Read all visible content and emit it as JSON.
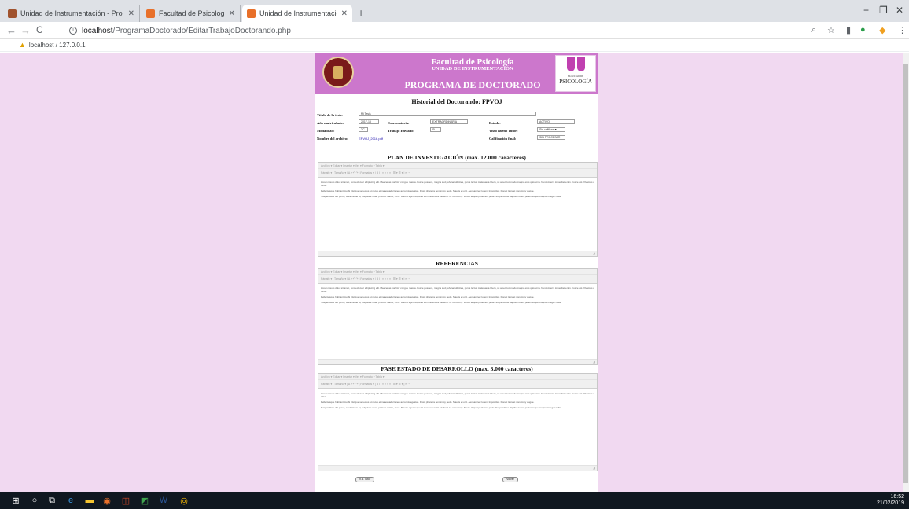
{
  "browser": {
    "tabs": [
      {
        "title": "Unidad de Instrumentación - Pro",
        "fav_color": "#a0522d",
        "active": false
      },
      {
        "title": "Facultad de Psicología. Intranet",
        "fav_color": "#e8702a",
        "active": false
      },
      {
        "title": "Unidad de Instrumentación - Pro",
        "fav_color": "#e8702a",
        "active": true
      }
    ],
    "new_tab": "+",
    "window_controls": {
      "minimize": "−",
      "maximize": "❐",
      "close": "✕"
    },
    "nav": {
      "back": "←",
      "forward": "→",
      "reload": "C"
    },
    "url_host": "localhost",
    "url_path": "/ProgramaDoctorado/EditarTrabajoDoctorando.php",
    "bookmark": "localhost / 127.0.0.1"
  },
  "page": {
    "header": {
      "faculty": "Facultad de Psicología",
      "unit": "UNIDAD DE INSTRUMENTACIÓN",
      "program": "PROGRAMA DE DOCTORADO",
      "logo_small": "FACULTAD DE",
      "logo_big": "PSICOLOGÍA"
    },
    "history_title": "Historial del Doctorando: FPVOJ",
    "fields": {
      "tesis_label": "Título de la tesis:",
      "tesis_value": "Mi Tesis",
      "anio_label": "Año matriculado:",
      "anio_value": "2017-18",
      "conv_label": "Convocatoria:",
      "conv_value": "EXTRAORDINARIA",
      "estado_label": "Estado:",
      "estado_value": "ACTIVO",
      "mod_label": "Modalidad:",
      "mod_value": "TC",
      "trabajo_label": "Trabajo Enviado:",
      "trabajo_value": "Si",
      "visto_label": "Visto Bueno Tutor:",
      "visto_value": "Sin calificar",
      "archivo_label": "Nombre del archivo:",
      "archivo_value": "EPVOJ_2016.pdf",
      "calif_label": "Calificación final:",
      "calif_value": "SIN PROCESAR"
    },
    "editor_menu": "Archivo ▾   Editar ▾   Insertar ▾   Ver ▾   Formato ▾   Tabla ▾",
    "editor_toolbar": "Párrafo ▾  |  Tamaño ▾  |  A ▾  ↶  ↷  |  Formatos ▾  |  B   I  |  ≡  ≡  ≡  ≡  |  ☰ ▾  ☰ ▾  |  ⇤  ⇥",
    "lorem1": "Lorem ipsum dolor sit amet, consectetuer adipiscing elit. Maecenas porttitor congue massa. Fusce posuere, magna sed pulvinar ultricies, purus lectus malesuada libero, sit amet commodo magna eros quis urna. Nunc viverra imperdiet enim. Fusce est. Vivamus a tellus.",
    "lorem2": "Pellentesque habitant morbi tristique senectus et netus et malesuada fames ac turpis egestas. Proin pharetra nonummy pede. Mauris et orci. Aenean nec lorem. In porttitor. Donec laoreet nonummy augue.",
    "lorem3": "Suspendisse dui purus, scelerisque at, vulputate vitae, pretium mattis, nunc. Mauris eget neque at sem venenatis eleifend. Ut nonummy. Fusce aliquet pede non pede. Suspendisse dapibus lorem pellentesque magna. Integer nulla.",
    "sections": {
      "plan": "PLAN DE INVESTIGACIÓN (max. 12.000 caracteres)",
      "refs": "REFERENCIAS",
      "fase": "FASE ESTADO DE DESARROLLO (max. 3.000 caracteres)"
    },
    "buttons": {
      "vb_tutor": "V.B.Tutor",
      "volver": "Volver"
    }
  },
  "taskbar": {
    "time": "16:52",
    "date": "21/02/2019",
    "icons": [
      {
        "name": "windows-start-icon",
        "glyph": "⊞",
        "color": "#ffffff"
      },
      {
        "name": "search-circle-icon",
        "glyph": "○",
        "color": "#ffffff"
      },
      {
        "name": "task-view-icon",
        "glyph": "⧉",
        "color": "#ffffff"
      },
      {
        "name": "edge-icon",
        "glyph": "e",
        "color": "#3a96dd"
      },
      {
        "name": "file-explorer-icon",
        "glyph": "▬",
        "color": "#f4c430"
      },
      {
        "name": "app-orange-icon",
        "glyph": "◉",
        "color": "#e8702a"
      },
      {
        "name": "app-powerpoint-icon",
        "glyph": "◫",
        "color": "#d24726"
      },
      {
        "name": "app-green-icon",
        "glyph": "◩",
        "color": "#3fa34d"
      },
      {
        "name": "word-icon",
        "glyph": "W",
        "color": "#2b579a"
      },
      {
        "name": "chrome-icon",
        "glyph": "◎",
        "color": "#fbbc05"
      }
    ]
  }
}
